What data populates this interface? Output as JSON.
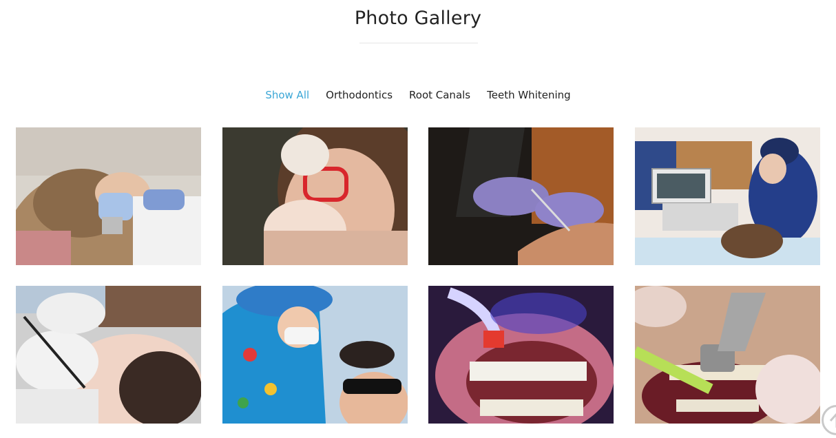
{
  "gallery": {
    "title": "Photo Gallery",
    "active_color": "#3aa6d6",
    "filters": [
      {
        "label": "Show All",
        "active": true
      },
      {
        "label": "Orthodontics",
        "active": false
      },
      {
        "label": "Root Canals",
        "active": false
      },
      {
        "label": "Teeth Whitening",
        "active": false
      }
    ],
    "photos": [
      {
        "subject": "boy in dental chair"
      },
      {
        "subject": "child with red glasses"
      },
      {
        "subject": "dentist with mirror"
      },
      {
        "subject": "dental clinic with x-ray screen"
      },
      {
        "subject": "woman dental checkup"
      },
      {
        "subject": "dentist in colorful scrubs with child"
      },
      {
        "subject": "blue curing light on teeth"
      },
      {
        "subject": "dental drill close-up"
      }
    ]
  },
  "scroll_top": {
    "icon": "arrow-up-icon"
  }
}
